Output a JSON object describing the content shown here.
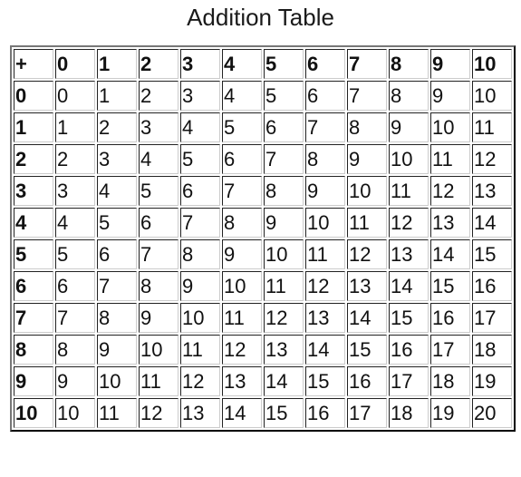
{
  "title": "Addition Table",
  "table": {
    "corner": "+",
    "column_headers": [
      "0",
      "1",
      "2",
      "3",
      "4",
      "5",
      "6",
      "7",
      "8",
      "9",
      "10"
    ],
    "rows": [
      {
        "header": "0",
        "cells": [
          "0",
          "1",
          "2",
          "3",
          "4",
          "5",
          "6",
          "7",
          "8",
          "9",
          "10"
        ]
      },
      {
        "header": "1",
        "cells": [
          "1",
          "2",
          "3",
          "4",
          "5",
          "6",
          "7",
          "8",
          "9",
          "10",
          "11"
        ]
      },
      {
        "header": "2",
        "cells": [
          "2",
          "3",
          "4",
          "5",
          "6",
          "7",
          "8",
          "9",
          "10",
          "11",
          "12"
        ]
      },
      {
        "header": "3",
        "cells": [
          "3",
          "4",
          "5",
          "6",
          "7",
          "8",
          "9",
          "10",
          "11",
          "12",
          "13"
        ]
      },
      {
        "header": "4",
        "cells": [
          "4",
          "5",
          "6",
          "7",
          "8",
          "9",
          "10",
          "11",
          "12",
          "13",
          "14"
        ]
      },
      {
        "header": "5",
        "cells": [
          "5",
          "6",
          "7",
          "8",
          "9",
          "10",
          "11",
          "12",
          "13",
          "14",
          "15"
        ]
      },
      {
        "header": "6",
        "cells": [
          "6",
          "7",
          "8",
          "9",
          "10",
          "11",
          "12",
          "13",
          "14",
          "15",
          "16"
        ]
      },
      {
        "header": "7",
        "cells": [
          "7",
          "8",
          "9",
          "10",
          "11",
          "12",
          "13",
          "14",
          "15",
          "16",
          "17"
        ]
      },
      {
        "header": "8",
        "cells": [
          "8",
          "9",
          "10",
          "11",
          "12",
          "13",
          "14",
          "15",
          "16",
          "17",
          "18"
        ]
      },
      {
        "header": "9",
        "cells": [
          "9",
          "10",
          "11",
          "12",
          "13",
          "14",
          "15",
          "16",
          "17",
          "18",
          "19"
        ]
      },
      {
        "header": "10",
        "cells": [
          "10",
          "11",
          "12",
          "13",
          "14",
          "15",
          "16",
          "17",
          "18",
          "19",
          "20"
        ]
      }
    ]
  }
}
